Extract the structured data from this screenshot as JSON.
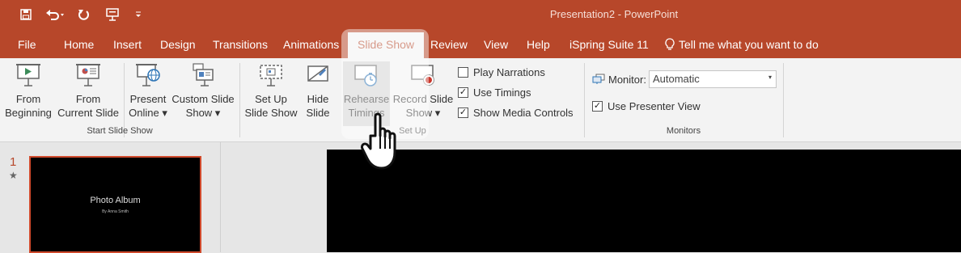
{
  "window": {
    "title": "Presentation2  -  PowerPoint",
    "title_bar_color": "#b7472a"
  },
  "quick_access": {
    "save_icon": "save-icon",
    "undo_icon": "undo-icon",
    "redo_icon": "redo-icon",
    "present_icon": "present-from-start-icon",
    "customize_icon": "customize-qat-icon"
  },
  "tabs": [
    {
      "label": "File"
    },
    {
      "label": "Home"
    },
    {
      "label": "Insert"
    },
    {
      "label": "Design"
    },
    {
      "label": "Transitions"
    },
    {
      "label": "Animations"
    },
    {
      "label": "Slide Show",
      "active": true
    },
    {
      "label": "Review"
    },
    {
      "label": "View"
    },
    {
      "label": "Help"
    },
    {
      "label": "iSpring Suite 11"
    }
  ],
  "tell_me": {
    "label": "Tell me what you want to do",
    "icon": "lightbulb-icon"
  },
  "ribbon": {
    "start_slide_show": {
      "group_label": "Start Slide Show",
      "from_beginning": {
        "line1": "From",
        "line2": "Beginning"
      },
      "from_current": {
        "line1": "From",
        "line2": "Current Slide"
      },
      "present_online": {
        "line1": "Present",
        "line2": "Online ▾"
      },
      "custom_slide_show": {
        "line1": "Custom Slide",
        "line2": "Show ▾"
      }
    },
    "set_up": {
      "group_label": "Set Up",
      "set_up_slide_show": {
        "line1": "Set Up",
        "line2": "Slide Show"
      },
      "hide_slide": {
        "line1": "Hide",
        "line2": "Slide"
      },
      "rehearse_timings": {
        "line1": "Rehearse",
        "line2": "Timings"
      },
      "record_slide_show": {
        "line1": "Record Slide",
        "line2": "Show ▾"
      },
      "play_narrations": {
        "label": "Play Narrations",
        "checked": false
      },
      "use_timings": {
        "label": "Use Timings",
        "checked": true
      },
      "show_media_controls": {
        "label": "Show Media Controls",
        "checked": true
      }
    },
    "monitors": {
      "group_label": "Monitors",
      "monitor_label": "Monitor:",
      "monitor_value": "Automatic",
      "use_presenter_view": {
        "label": "Use Presenter View",
        "checked": true
      }
    }
  },
  "slides": {
    "number": "1",
    "star": "★",
    "thumb_title": "Photo Album",
    "thumb_subtitle": "By Anna Smith"
  },
  "checkmark": "✓",
  "accent": "#b7472a"
}
